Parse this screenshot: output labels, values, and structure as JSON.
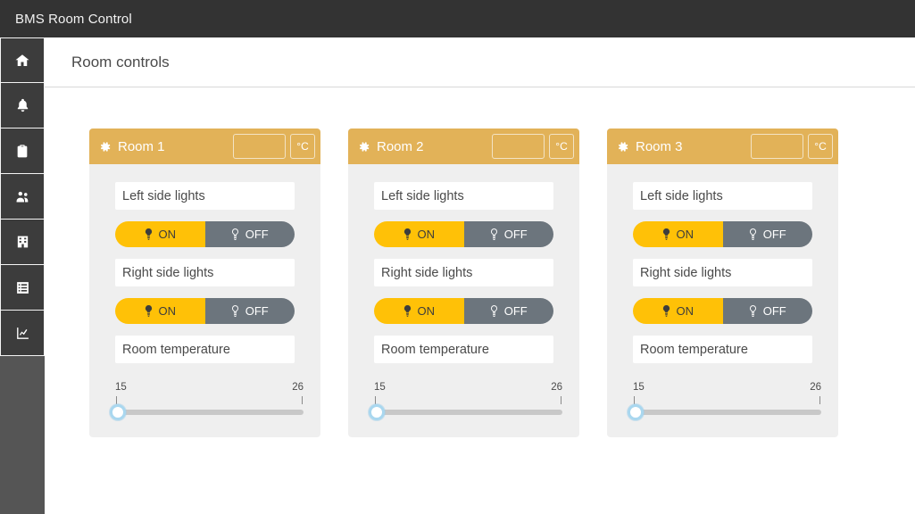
{
  "topbar": {
    "title": "BMS Room Control"
  },
  "sidebar": {
    "items": [
      {
        "icon": "home-icon",
        "name": "sidebar-item-home"
      },
      {
        "icon": "bell-icon",
        "name": "sidebar-item-alerts"
      },
      {
        "icon": "clipboard-icon",
        "name": "sidebar-item-tasks"
      },
      {
        "icon": "users-icon",
        "name": "sidebar-item-users"
      },
      {
        "icon": "building-icon",
        "name": "sidebar-item-building"
      },
      {
        "icon": "list-icon",
        "name": "sidebar-item-list"
      },
      {
        "icon": "chart-line-icon",
        "name": "sidebar-item-reports"
      }
    ]
  },
  "page": {
    "title": "Room controls"
  },
  "colors": {
    "card_header": "#e2b258",
    "toggle_on": "#ffc107",
    "toggle_off": "#6c757d",
    "card_body": "#efefef",
    "topbar": "#333333",
    "sidebar": "#555555",
    "slider_handle_ring": "#a9d7ef"
  },
  "cards": [
    {
      "title": "Room 1",
      "gear_icon": "gear-icon",
      "temperature_value": "",
      "temperature_placeholder": "",
      "temperature_unit": "°C",
      "controls": [
        {
          "label": "Left side lights",
          "toggle": {
            "on_label": "ON",
            "off_label": "OFF",
            "on_icon": "lightbulb-filled-icon",
            "off_icon": "lightbulb-outline-icon",
            "state": "ON"
          }
        },
        {
          "label": "Right side lights",
          "toggle": {
            "on_label": "ON",
            "off_label": "OFF",
            "on_icon": "lightbulb-filled-icon",
            "off_icon": "lightbulb-outline-icon",
            "state": "ON"
          }
        }
      ],
      "slider": {
        "label": "Room temperature",
        "min": "15",
        "max": "26",
        "value": "15"
      }
    },
    {
      "title": "Room 2",
      "gear_icon": "gear-icon",
      "temperature_value": "",
      "temperature_placeholder": "",
      "temperature_unit": "°C",
      "controls": [
        {
          "label": "Left side lights",
          "toggle": {
            "on_label": "ON",
            "off_label": "OFF",
            "on_icon": "lightbulb-filled-icon",
            "off_icon": "lightbulb-outline-icon",
            "state": "ON"
          }
        },
        {
          "label": "Right side lights",
          "toggle": {
            "on_label": "ON",
            "off_label": "OFF",
            "on_icon": "lightbulb-filled-icon",
            "off_icon": "lightbulb-outline-icon",
            "state": "ON"
          }
        }
      ],
      "slider": {
        "label": "Room temperature",
        "min": "15",
        "max": "26",
        "value": "15"
      }
    },
    {
      "title": "Room 3",
      "gear_icon": "gear-icon",
      "temperature_value": "",
      "temperature_placeholder": "",
      "temperature_unit": "°C",
      "controls": [
        {
          "label": "Left side lights",
          "toggle": {
            "on_label": "ON",
            "off_label": "OFF",
            "on_icon": "lightbulb-filled-icon",
            "off_icon": "lightbulb-outline-icon",
            "state": "ON"
          }
        },
        {
          "label": "Right side lights",
          "toggle": {
            "on_label": "ON",
            "off_label": "OFF",
            "on_icon": "lightbulb-filled-icon",
            "off_icon": "lightbulb-outline-icon",
            "state": "ON"
          }
        }
      ],
      "slider": {
        "label": "Room temperature",
        "min": "15",
        "max": "26",
        "value": "15"
      }
    }
  ]
}
